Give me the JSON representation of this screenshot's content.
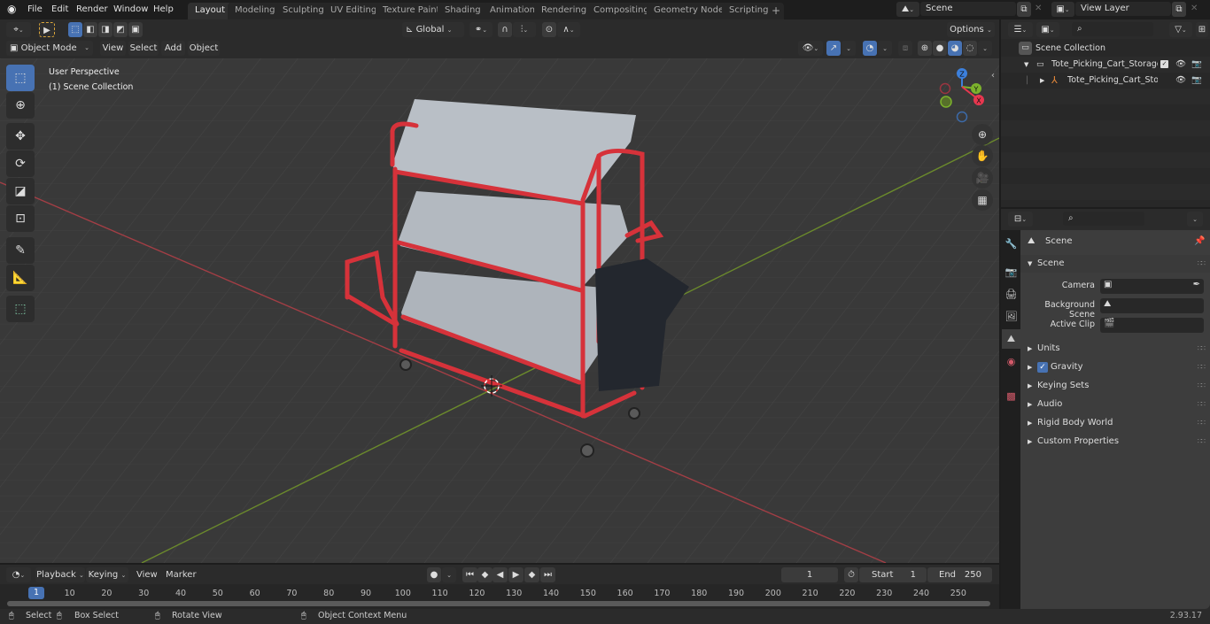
{
  "topbar": {
    "menus": [
      "File",
      "Edit",
      "Render",
      "Window",
      "Help"
    ],
    "workspaces": [
      "Layout",
      "Modeling",
      "Sculpting",
      "UV Editing",
      "Texture Paint",
      "Shading",
      "Animation",
      "Rendering",
      "Compositing",
      "Geometry Nodes",
      "Scripting"
    ],
    "active_workspace": "Layout",
    "add_workspace": "+",
    "scene_name": "Scene",
    "view_layer_name": "View Layer"
  },
  "viewport_header": {
    "mode": "Object Mode",
    "menus": [
      "View",
      "Select",
      "Add",
      "Object"
    ],
    "orientation": "Global",
    "options": "Options"
  },
  "viewport": {
    "perspective": "User Perspective",
    "collection": "(1) Scene Collection",
    "gizmo_axes": [
      "Z",
      "Y",
      "X"
    ],
    "tools": [
      "select-box",
      "cursor",
      "move",
      "rotate",
      "scale",
      "transform",
      "annotate",
      "measure",
      "add-cube"
    ]
  },
  "outliner": {
    "root": "Scene Collection",
    "items": [
      {
        "name": "Tote_Picking_Cart_Storage_Bı",
        "type": "collection",
        "expanded": true,
        "checked": true
      },
      {
        "name": "Tote_Picking_Cart_Storaç",
        "type": "empty",
        "expanded": false
      }
    ]
  },
  "properties": {
    "context": "Scene",
    "section": "Scene",
    "fields": [
      {
        "label": "Camera",
        "value": ""
      },
      {
        "label": "Background Scene",
        "value": ""
      },
      {
        "label": "Active Clip",
        "value": ""
      }
    ],
    "subpanels": [
      "Units",
      "Gravity",
      "Keying Sets",
      "Audio",
      "Rigid Body World",
      "Custom Properties"
    ],
    "gravity_enabled": true
  },
  "timeline": {
    "menus": [
      "Playback",
      "Keying",
      "View",
      "Marker"
    ],
    "current_frame": "1",
    "start_label": "Start",
    "start": "1",
    "end_label": "End",
    "end": "250",
    "ticks": [
      "10",
      "20",
      "30",
      "40",
      "50",
      "60",
      "70",
      "80",
      "90",
      "100",
      "110",
      "120",
      "130",
      "140",
      "150",
      "160",
      "170",
      "180",
      "190",
      "200",
      "210",
      "220",
      "230",
      "240",
      "250"
    ],
    "playhead": "1"
  },
  "statusbar": {
    "select": "Select",
    "box_select": "Box Select",
    "rotate_view": "Rotate View",
    "context_menu": "Object Context Menu",
    "version": "2.93.17"
  },
  "colors": {
    "accent": "#4772b3",
    "x_axis": "#e8374f",
    "y_axis": "#7cb22c",
    "z_axis": "#3c80dc",
    "cart_frame": "#d6323a",
    "shelf": "#b4bac2",
    "bin": "#23272e"
  }
}
